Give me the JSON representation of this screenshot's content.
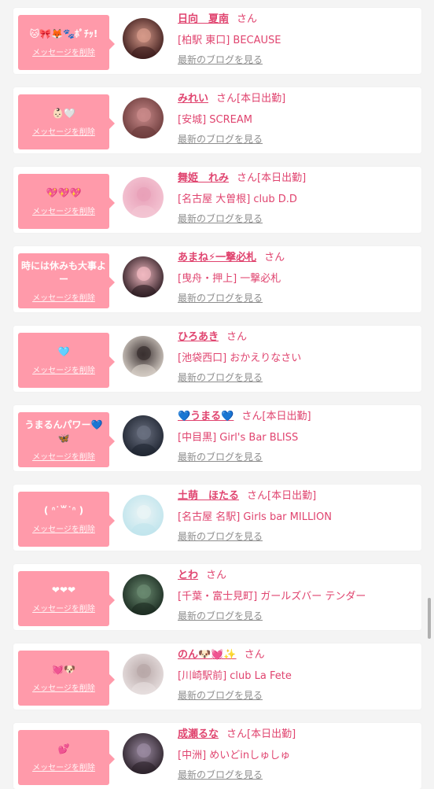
{
  "colors": {
    "bubble": "#ff9aaa",
    "name": "#e0446f",
    "link": "#8e8e8e"
  },
  "entries": [
    {
      "message": "🐱🎀🦊🐾ﾎﾟﾁｯ!",
      "delete_label": "メッセージを削除",
      "name": "日向　夏南",
      "honorific": "さん",
      "today": "",
      "shop": "[柏駅 東口] BECAUSE",
      "blog": "最新のブログを見る"
    },
    {
      "message": "👶🏻🤍",
      "delete_label": "メッセージを削除",
      "name": "みれい",
      "honorific": "さん",
      "today": "[本日出勤]",
      "shop": "[安城] SCREAM",
      "blog": "最新のブログを見る"
    },
    {
      "message": "💖💖💖",
      "delete_label": "メッセージを削除",
      "name": "舞姫　れみ",
      "honorific": "さん",
      "today": "[本日出勤]",
      "shop": "[名古屋 大曽根] club D.D",
      "blog": "最新のブログを見る"
    },
    {
      "message": "時には休みも大事よー",
      "delete_label": "メッセージを削除",
      "name": "あまね⚡一撃必札",
      "honorific": "さん",
      "today": "",
      "shop": "[曳舟・押上] 一撃必札",
      "blog": "最新のブログを見る"
    },
    {
      "message": "🩵",
      "delete_label": "メッセージを削除",
      "name": "ひろあき",
      "honorific": "さん",
      "today": "",
      "shop": "[池袋西口] おかえりなさい",
      "blog": "最新のブログを見る"
    },
    {
      "message": "うまるんパワー💙🦋",
      "delete_label": "メッセージを削除",
      "name": "💙うまる💙",
      "honorific": "さん",
      "today": "[本日出勤]",
      "shop": "[中目黒] Girl's Bar BLISS",
      "blog": "最新のブログを見る"
    },
    {
      "message": "( ᐢ˙꒳˙ᐢ )",
      "delete_label": "メッセージを削除",
      "name": "土萌　ほたる",
      "honorific": "さん",
      "today": "[本日出勤]",
      "shop": "[名古屋 名駅] Girls bar MILLION",
      "blog": "最新のブログを見る"
    },
    {
      "message": "❤❤❤",
      "delete_label": "メッセージを削除",
      "name": "とわ",
      "honorific": "さん",
      "today": "",
      "shop": "[千葉・富士見町] ガールズバー テンダー",
      "blog": "最新のブログを見る"
    },
    {
      "message": "💓🐶",
      "delete_label": "メッセージを削除",
      "name": "のん🐶💓✨",
      "honorific": "さん",
      "today": "",
      "shop": "[川崎駅前] club La Fete",
      "blog": "最新のブログを見る"
    },
    {
      "message": "💕",
      "delete_label": "メッセージを削除",
      "name": "成瀬るな",
      "honorific": "さん",
      "today": "[本日出勤]",
      "shop": "[中洲] めいどinしゅしゅ",
      "blog": "最新のブログを見る"
    }
  ]
}
